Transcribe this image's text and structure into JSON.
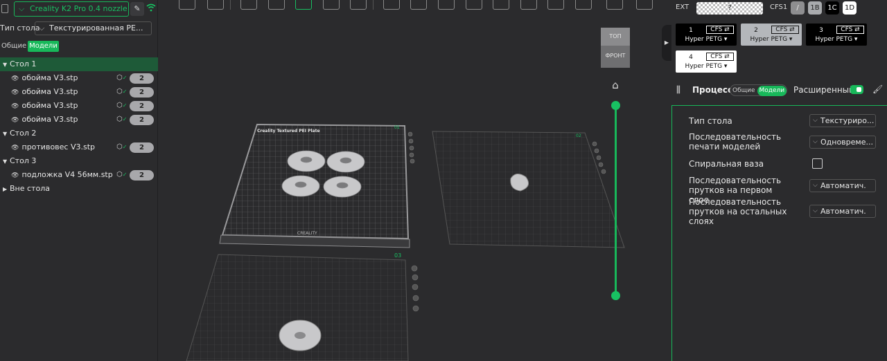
{
  "left_panel": {
    "printer_name": "Creality K2 Pro 0.4 nozzle",
    "bed_label": "Тип стола",
    "bed_value": "Текстурированная PE...",
    "tabs": [
      "Общие",
      "Модели"
    ],
    "tree": [
      {
        "type": "plate",
        "label": "Стол 1",
        "selected": true
      },
      {
        "type": "item",
        "label": "обойма V3.stp",
        "count": "2"
      },
      {
        "type": "item",
        "label": "обойма V3.stp",
        "count": "2"
      },
      {
        "type": "item",
        "label": "обойма V3.stp",
        "count": "2"
      },
      {
        "type": "item",
        "label": "обойма V3.stp",
        "count": "2"
      },
      {
        "type": "plate",
        "label": "Стол 2"
      },
      {
        "type": "item",
        "label": "противовес V3.stp",
        "count": "2"
      },
      {
        "type": "plate",
        "label": "Стол 3"
      },
      {
        "type": "item",
        "label": "подложка V4 56мм.stp",
        "count": "2"
      },
      {
        "type": "collapsed",
        "label": "Вне стола"
      }
    ]
  },
  "viewport": {
    "navcube_top": "ТОП",
    "navcube_front": "ФРОНТ",
    "plate1_title": "Creality Textured PEI Plate",
    "plate1_num": "01",
    "plate2_num": "02",
    "plate3_num": "03",
    "brand": "CREALITY"
  },
  "right_panel": {
    "ext_label": "EXT",
    "ext_value": "?",
    "cfs_label": "CFS1",
    "slots": [
      "/",
      "1B",
      "1C",
      "1D"
    ],
    "filaments": [
      {
        "num": "1",
        "tag": "CFS ⇄",
        "material": "Hyper PETG"
      },
      {
        "num": "2",
        "tag": "CFS ⇄",
        "material": "Hyper PETG"
      },
      {
        "num": "3",
        "tag": "CFS ⇄",
        "material": "Hyper PETG"
      },
      {
        "num": "4",
        "tag": "CFS ⇄",
        "material": "Hyper PETG"
      }
    ],
    "process_title": "Процесс",
    "process_tabs": [
      "Общие",
      "Модели"
    ],
    "advanced_label": "Расширенный",
    "settings": [
      {
        "label": "Тип стола",
        "value": "Текстуриро..."
      },
      {
        "label": "Последовательность печати моделей",
        "value": "Одновреме..."
      },
      {
        "label": "Спиральная ваза",
        "value": ""
      },
      {
        "label": "Последовательность прутков на первом слое",
        "value": "Автоматич."
      },
      {
        "label": "Последовательность прутков на остальных слоях",
        "value": "Автоматич."
      }
    ]
  },
  "colors": {
    "accent": "#18b85a",
    "panel_bg": "#2b2b2d",
    "viewport_bg": "#2f2f31"
  }
}
